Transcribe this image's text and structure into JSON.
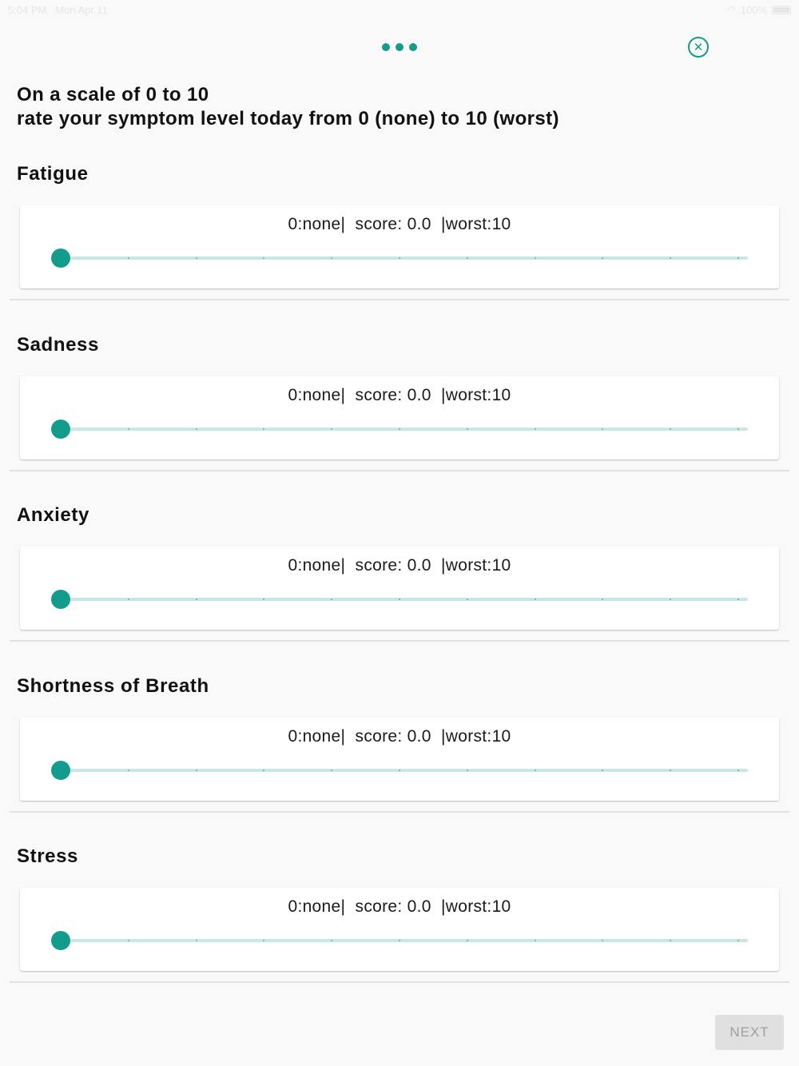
{
  "status_bar": {
    "time": "5:04 PM",
    "date": "Mon Apr 11",
    "battery_text": "100%"
  },
  "header": {
    "instruction_line1": "On a scale of 0 to 10",
    "instruction_line2": "rate your symptom level today from 0 (none) to 10 (worst)"
  },
  "symptoms": [
    {
      "title": "Fatigue",
      "score_line": "0:none|  score: 0.0  |worst:10",
      "value": 0,
      "min": 0,
      "max": 10
    },
    {
      "title": "Sadness",
      "score_line": "0:none|  score: 0.0  |worst:10",
      "value": 0,
      "min": 0,
      "max": 10
    },
    {
      "title": "Anxiety",
      "score_line": "0:none|  score: 0.0  |worst:10",
      "value": 0,
      "min": 0,
      "max": 10
    },
    {
      "title": "Shortness of Breath",
      "score_line": "0:none|  score: 0.0  |worst:10",
      "value": 0,
      "min": 0,
      "max": 10
    },
    {
      "title": "Stress",
      "score_line": "0:none|  score: 0.0  |worst:10",
      "value": 0,
      "min": 0,
      "max": 10
    }
  ],
  "footer": {
    "next_label": "NEXT"
  },
  "colors": {
    "accent": "#129c8c",
    "track": "#c8e8e8",
    "disabled_button_bg": "#e0e0e0",
    "disabled_button_text": "#9e9e9e"
  },
  "icons": {
    "more": "more-horizontal-icon",
    "close": "close-circle-icon"
  }
}
